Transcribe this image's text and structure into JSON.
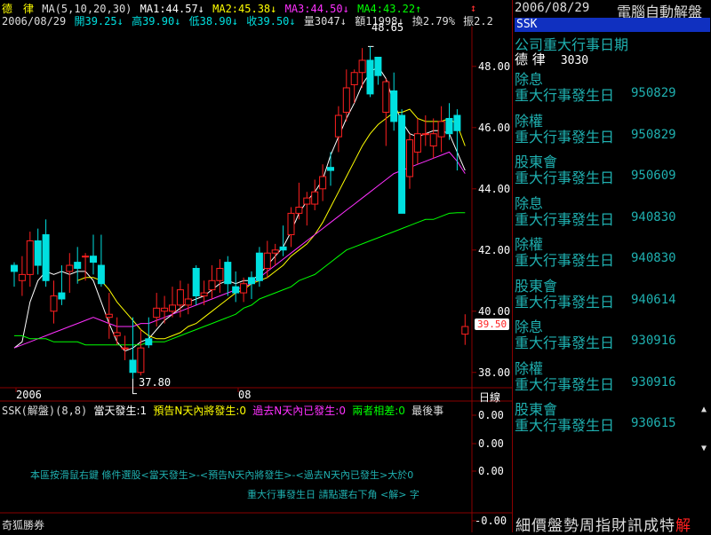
{
  "header": {
    "stock_name": "德　律",
    "ma_label": "MA(5,10,20,30)",
    "ma1": "MA1:44.57↓",
    "ma2": "MA2:45.38↓",
    "ma3": "MA3:44.50↓",
    "ma4": "MA4:43.22↑",
    "date": "2006/08/29",
    "open": "開39.25↓",
    "high": "高39.90↓",
    "low": "低38.90↓",
    "close": "收39.50↓",
    "volume": "量3047↓",
    "amount": "額11998↓",
    "change": "換2.79%",
    "amplitude": "振2.2"
  },
  "colors": {
    "ma1": "#ffffff",
    "ma2": "#ffff00",
    "ma3": "#ff30ff",
    "ma4": "#00ff00",
    "up_candle": "#ff2020",
    "down_candle": "#00e0e0",
    "axis": "#8a0000",
    "axis_text": "#ffffff",
    "panel_text": "#1fb0b0"
  },
  "chart_data": {
    "type": "candlestick",
    "title": "德 律 MA(5,10,20,30)",
    "y_ticks": [
      "48.00",
      "46.00",
      "44.00",
      "42.00",
      "40.00",
      "38.00"
    ],
    "ylim": [
      37.5,
      49.3
    ],
    "x_labels": [
      "2006",
      "08"
    ],
    "period_label": "日線",
    "high_annotation": "48.65",
    "low_annotation": "37.80",
    "last_price": "39.50",
    "candles": [
      [
        41.5,
        41.3,
        41.6,
        40.8
      ],
      [
        41.0,
        41.2,
        41.8,
        40.5
      ],
      [
        41.2,
        42.3,
        42.6,
        40.8
      ],
      [
        42.3,
        41.5,
        42.7,
        41.2
      ],
      [
        42.5,
        41.0,
        43.0,
        40.8
      ],
      [
        40.0,
        40.5,
        41.0,
        39.6
      ],
      [
        40.6,
        40.4,
        41.5,
        40.2
      ],
      [
        41.3,
        41.5,
        41.9,
        40.6
      ],
      [
        41.6,
        41.4,
        42.1,
        40.9
      ],
      [
        41.8,
        41.8,
        41.9,
        41.0
      ],
      [
        41.8,
        41.6,
        42.5,
        41.2
      ],
      [
        41.5,
        40.9,
        42.5,
        40.8
      ],
      [
        39.8,
        39.9,
        40.6,
        39.1
      ],
      [
        39.2,
        39.3,
        39.8,
        38.9
      ],
      [
        38.8,
        38.8,
        39.2,
        38.4
      ],
      [
        38.4,
        38.0,
        39.8,
        37.8
      ],
      [
        38.0,
        38.8,
        39.4,
        37.9
      ],
      [
        39.1,
        38.9,
        39.8,
        38.8
      ],
      [
        39.8,
        40.1,
        40.6,
        39.5
      ],
      [
        40.0,
        40.1,
        40.5,
        39.6
      ],
      [
        40.0,
        40.2,
        40.8,
        39.8
      ],
      [
        40.2,
        40.7,
        41.0,
        39.8
      ],
      [
        40.2,
        40.4,
        40.9,
        39.9
      ],
      [
        41.4,
        40.5,
        41.5,
        40.2
      ],
      [
        40.5,
        40.6,
        41.0,
        40.2
      ],
      [
        40.7,
        41.0,
        41.5,
        40.4
      ],
      [
        41.0,
        41.4,
        41.7,
        40.6
      ],
      [
        41.6,
        40.9,
        41.8,
        40.5
      ],
      [
        40.8,
        40.6,
        41.3,
        40.3
      ],
      [
        40.6,
        40.9,
        41.1,
        40.3
      ],
      [
        41.1,
        40.9,
        41.3,
        40.4
      ],
      [
        41.9,
        41.0,
        42.1,
        40.8
      ],
      [
        41.4,
        41.9,
        42.3,
        41.1
      ],
      [
        41.9,
        42.0,
        42.2,
        41.5
      ],
      [
        42.1,
        42.0,
        42.8,
        41.8
      ],
      [
        42.5,
        43.2,
        43.4,
        42.1
      ],
      [
        43.2,
        43.4,
        44.2,
        43.0
      ],
      [
        43.5,
        43.7,
        43.9,
        42.8
      ],
      [
        43.5,
        43.9,
        44.3,
        43.3
      ],
      [
        44.0,
        44.4,
        44.8,
        43.6
      ],
      [
        44.7,
        44.6,
        45.2,
        44.1
      ],
      [
        45.7,
        46.4,
        46.7,
        45.2
      ],
      [
        46.5,
        47.3,
        47.9,
        46.2
      ],
      [
        47.4,
        47.8,
        47.9,
        46.8
      ],
      [
        47.8,
        48.2,
        48.6,
        47.3
      ],
      [
        48.2,
        47.1,
        48.65,
        47.0
      ],
      [
        48.3,
        47.7,
        48.3,
        47.4
      ],
      [
        46.5,
        47.5,
        47.6,
        45.4
      ],
      [
        47.2,
        46.2,
        47.8,
        45.9
      ],
      [
        46.4,
        43.2,
        46.6,
        43.2
      ],
      [
        44.4,
        45.6,
        45.8,
        44.0
      ],
      [
        45.2,
        45.8,
        46.3,
        44.8
      ],
      [
        45.8,
        45.8,
        46.4,
        45.4
      ],
      [
        45.4,
        45.8,
        46.3,
        45.0
      ],
      [
        45.7,
        46.2,
        46.7,
        45.2
      ],
      [
        46.3,
        45.8,
        46.8,
        45.6
      ],
      [
        46.4,
        45.9,
        46.6,
        44.6
      ],
      [
        39.25,
        39.5,
        39.9,
        38.9
      ]
    ],
    "series": [
      {
        "name": "MA1",
        "values": [
          38.8,
          39.0,
          40.3,
          41.0,
          41.3,
          41.2,
          41.3,
          41.2,
          41.3,
          41.3,
          41.0,
          40.3,
          39.6,
          39.0,
          38.7,
          38.8,
          39.0,
          39.1,
          39.4,
          39.7,
          39.9,
          40.1,
          40.3,
          40.4,
          40.5,
          40.7,
          40.9,
          41.0,
          40.9,
          41.0,
          41.0,
          41.2,
          41.5,
          41.8,
          42.1,
          42.6,
          43.2,
          43.6,
          43.9,
          44.3,
          45.1,
          45.7,
          46.3,
          46.8,
          47.4,
          47.8,
          48.0,
          47.6,
          46.8,
          46.2,
          45.8,
          45.7,
          45.8,
          45.9,
          45.9,
          45.8,
          45.2,
          44.6
        ]
      },
      {
        "name": "MA2",
        "values": [
          null,
          null,
          null,
          null,
          null,
          null,
          null,
          null,
          41.0,
          41.1,
          41.1,
          41.0,
          40.7,
          40.3,
          40.0,
          39.7,
          39.4,
          39.2,
          39.1,
          39.1,
          39.2,
          39.3,
          39.5,
          39.6,
          39.8,
          40.0,
          40.2,
          40.4,
          40.6,
          40.7,
          40.9,
          41.0,
          41.1,
          41.3,
          41.5,
          41.8,
          42.0,
          42.2,
          42.5,
          42.9,
          43.4,
          43.9,
          44.4,
          44.9,
          45.4,
          45.8,
          46.1,
          46.3,
          46.5,
          46.5,
          46.6,
          46.3,
          46.2,
          46.2,
          46.2,
          46.3,
          46.1,
          45.4
        ]
      },
      {
        "name": "MA3",
        "values": [
          38.8,
          38.9,
          39.0,
          39.1,
          39.2,
          39.3,
          39.4,
          39.5,
          39.6,
          39.7,
          39.8,
          39.7,
          39.6,
          39.5,
          39.5,
          39.5,
          39.6,
          39.6,
          39.7,
          39.8,
          39.9,
          40.0,
          40.1,
          40.2,
          40.3,
          40.4,
          40.5,
          40.6,
          40.7,
          40.8,
          40.9,
          41.1,
          41.3,
          41.5,
          41.7,
          41.9,
          42.1,
          42.3,
          42.5,
          42.7,
          42.9,
          43.1,
          43.3,
          43.5,
          43.7,
          43.9,
          44.1,
          44.3,
          44.5,
          44.6,
          44.7,
          44.8,
          44.9,
          45.0,
          45.1,
          45.2,
          44.9,
          44.5
        ]
      },
      {
        "name": "MA4",
        "values": [
          39.2,
          39.2,
          39.1,
          39.1,
          39.1,
          39.0,
          39.0,
          39.0,
          39.0,
          38.9,
          38.9,
          38.9,
          38.9,
          38.9,
          38.9,
          38.9,
          38.9,
          39.0,
          39.0,
          39.0,
          39.1,
          39.2,
          39.3,
          39.4,
          39.5,
          39.6,
          39.7,
          39.8,
          39.9,
          40.1,
          40.2,
          40.4,
          40.5,
          40.6,
          40.7,
          40.8,
          41.0,
          41.1,
          41.2,
          41.4,
          41.6,
          41.8,
          42.0,
          42.1,
          42.2,
          42.3,
          42.4,
          42.5,
          42.6,
          42.7,
          42.8,
          42.9,
          43.0,
          43.0,
          43.1,
          43.2,
          43.22,
          43.22
        ]
      }
    ]
  },
  "indicator": {
    "label": "SSK(解盤)(8,8)",
    "today": "當天發生:1",
    "predict": "預告N天內將發生:0",
    "past": "過去N天內已發生:0",
    "diff": "兩者相差:0",
    "last": "最後事",
    "y_ticks": [
      "0.00",
      "0.00",
      "0.00",
      "-0.00"
    ],
    "instruction1": "本區按滑鼠右鍵 條件選股<當天發生>-<預告N天內將發生>-<過去N天內已發生>大於0",
    "instruction2": "重大行事發生日 請點選右下角 <解> 字"
  },
  "footer": {
    "brokerage": "奇狐勝券"
  },
  "right_panel": {
    "date": "2006/08/29",
    "title": "電腦自動解盤",
    "tab": "SSK",
    "heading": "公司重大行事日期",
    "stock_name": "德 律",
    "stock_code": "3030",
    "events": [
      {
        "type": "除息",
        "desc": "重大行事發生日",
        "date": "950829"
      },
      {
        "type": "除權",
        "desc": "重大行事發生日",
        "date": "950829"
      },
      {
        "type": "股東會",
        "desc": "重大行事發生日",
        "date": "950609"
      },
      {
        "type": "除息",
        "desc": "重大行事發生日",
        "date": "940830"
      },
      {
        "type": "除權",
        "desc": "重大行事發生日",
        "date": "940830"
      },
      {
        "type": "股東會",
        "desc": "重大行事發生日",
        "date": "940614"
      },
      {
        "type": "除息",
        "desc": "重大行事發生日",
        "date": "930916"
      },
      {
        "type": "除權",
        "desc": "重大行事發生日",
        "date": "930916"
      },
      {
        "type": "股東會",
        "desc": "重大行事發生日",
        "date": "930615"
      }
    ],
    "bottom_tabs": [
      "細",
      "價",
      "盤",
      "勢",
      "周",
      "指",
      "財",
      "訊",
      "成",
      "特",
      "解"
    ]
  }
}
